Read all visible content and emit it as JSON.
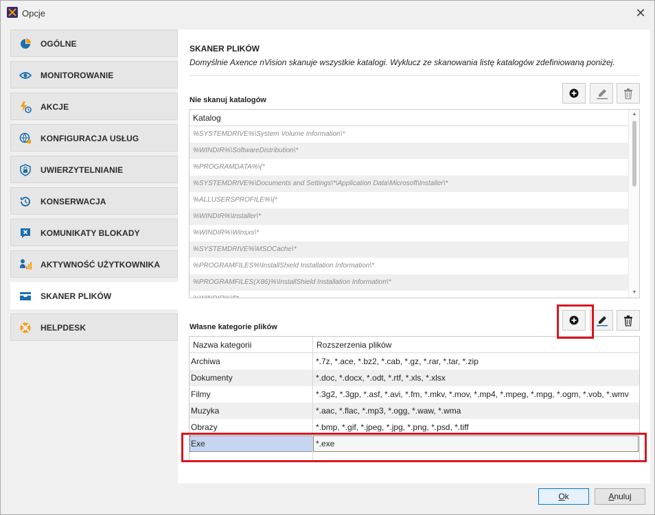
{
  "window": {
    "title": "Opcje"
  },
  "sidebar": {
    "items": [
      {
        "label": "OGÓLNE",
        "icon": "pie-chart-icon"
      },
      {
        "label": "MONITOROWANIE",
        "icon": "eye-icon"
      },
      {
        "label": "AKCJE",
        "icon": "lightning-clock-icon"
      },
      {
        "label": "KONFIGURACJA USŁUG",
        "icon": "globe-lock-icon"
      },
      {
        "label": "UWIERZYTELNIANIE",
        "icon": "shield-lock-icon"
      },
      {
        "label": "KONSERWACJA",
        "icon": "restore-icon"
      },
      {
        "label": "KOMUNIKATY BLOKADY",
        "icon": "blocked-message-icon"
      },
      {
        "label": "AKTYWNOŚĆ UŻYTKOWNIKA",
        "icon": "user-activity-icon"
      },
      {
        "label": "SKANER PLIKÓW",
        "icon": "inbox-scanner-icon"
      },
      {
        "label": "HELPDESK",
        "icon": "lifebuoy-icon"
      }
    ],
    "active_index": 8
  },
  "content": {
    "title": "SKANER PLIKÓW",
    "description": "Domyślnie Axence nVision skanuje wszystkie katalogi. Wyklucz ze skanowania listę katalogów zdefiniowaną poniżej.",
    "exclude_section": {
      "title": "Nie skanuj katalogów",
      "column": "Katalog",
      "rows": [
        "%SYSTEMDRIVE%\\System Volume Information\\*",
        "%WINDIR%\\SoftwareDistribution\\*",
        "%PROGRAMDATA%\\{*",
        "%SYSTEMDRIVE%\\Documents and Settings\\*\\Application Data\\Microsoft\\Installer\\*",
        "%ALLUSERSPROFILE%\\{*",
        "%WINDIR%\\Installer\\*",
        "%WINDIR%\\Winsxs\\*",
        "%SYSTEMDRIVE%\\MSOCache\\*",
        "%PROGRAMFILES%\\InstallShield Installation Information\\*",
        "%PROGRAMFILES(X86)%\\InstallShield Installation Information\\*",
        "%WINDIR%\\$*"
      ]
    },
    "categories_section": {
      "title": "Własne kategorie plików",
      "columns": [
        "Nazwa kategorii",
        "Rozszerzenia plików"
      ],
      "rows": [
        {
          "name": "Archiwa",
          "ext": "*.7z, *.ace, *.bz2, *.cab, *.gz, *.rar, *.tar, *.zip"
        },
        {
          "name": "Dokumenty",
          "ext": "*.doc, *.docx, *.odt, *.rtf, *.xls, *.xlsx"
        },
        {
          "name": "Filmy",
          "ext": "*.3g2, *.3gp, *.asf, *.avi, *.fm, *.mkv, *.mov, *.mp4, *.mpeg, *.mpg, *.ogm, *.vob, *.wmv"
        },
        {
          "name": "Muzyka",
          "ext": "*.aac, *.flac, *.mp3, *.ogg, *.waw, *.wma"
        },
        {
          "name": "Obrazy",
          "ext": "*.bmp, *.gif, *.jpeg, *.jpg, *.png, *.psd, *.tiff"
        },
        {
          "name": "Exe",
          "ext": "*.exe"
        }
      ],
      "selected_index": 5
    }
  },
  "footer": {
    "ok_accel": "O",
    "ok_rest": "k",
    "cancel_accel": "A",
    "cancel_rest": "nuluj"
  },
  "colors": {
    "accent": "#1c6fb0",
    "highlight": "#d8151f",
    "selection": "#c6d6f0"
  }
}
